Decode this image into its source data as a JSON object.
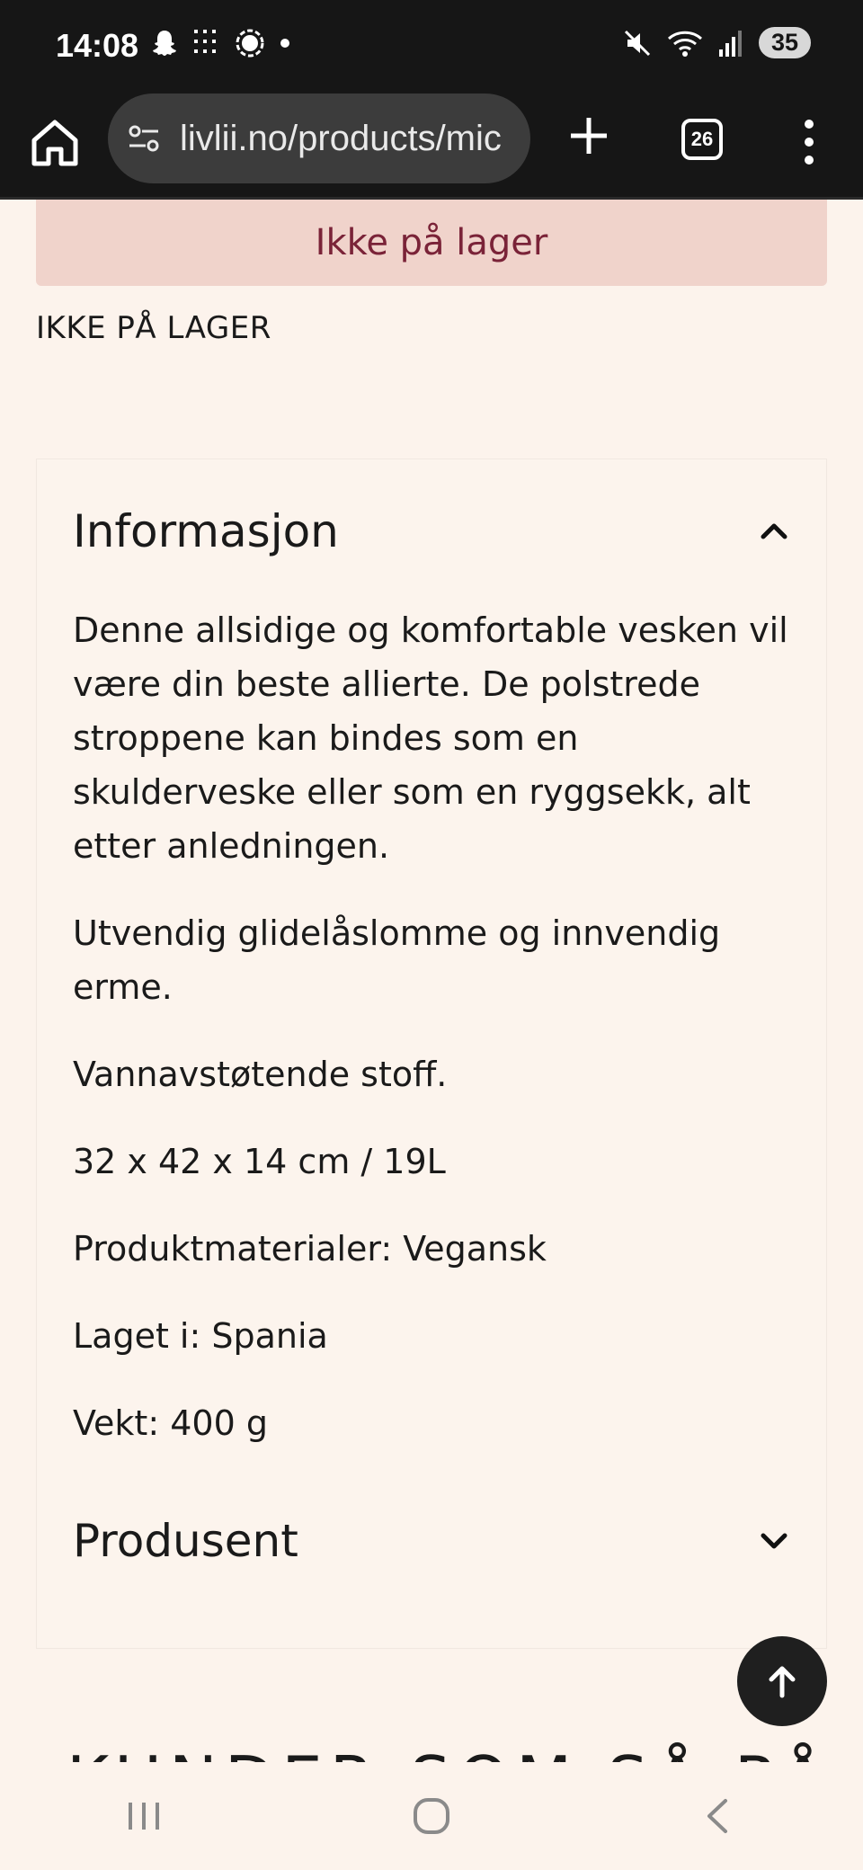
{
  "status_bar": {
    "time": "14:08",
    "battery": "35",
    "icons": [
      "snapchat-icon",
      "news-app-icon",
      "signal-app-icon",
      "dot-icon",
      "mute-icon",
      "wifi-icon",
      "cell-signal-icon"
    ]
  },
  "browser": {
    "url": "livlii.no/products/mic",
    "tab_count": "26"
  },
  "product": {
    "banner_text": "Ikke på lager",
    "stock_status": "IKKE PÅ LAGER"
  },
  "info_section": {
    "title": "Informasjon",
    "expanded": true,
    "paragraphs": [
      "Denne allsidige og komfortable vesken vil være din beste allierte. De polstrede stroppene kan bindes som en skulderveske eller som en ryggsekk, alt etter anledningen.",
      "Utvendig glidelåslomme og innvendig erme.",
      "Vannavstøtende stoff.",
      "32 x 42 x 14 cm / 19L",
      "Produktmaterialer: Vegansk",
      "Laget i: Spania",
      "Vekt: 400 g"
    ]
  },
  "producer_section": {
    "title": "Produsent",
    "expanded": false
  },
  "next_heading": "KUNDER SOM SÅ PÅ",
  "colors": {
    "page_bg": "#fcf3ec",
    "banner_bg": "#f0d3cb",
    "banner_text": "#7a2338",
    "chrome_dark": "#161616"
  }
}
